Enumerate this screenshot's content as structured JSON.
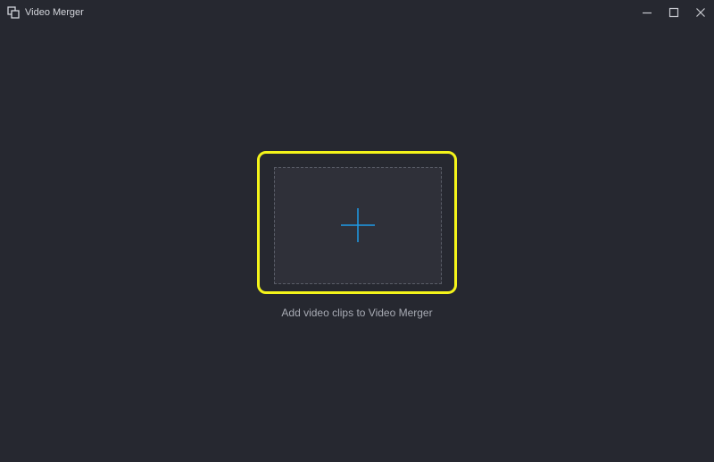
{
  "window": {
    "title": "Video Merger",
    "app_icon": "video-merger-app-icon",
    "controls": {
      "minimize_icon": "minimize-icon",
      "maximize_icon": "maximize-icon",
      "close_icon": "close-icon"
    }
  },
  "main": {
    "add_icon": "plus-icon",
    "caption": "Add video clips to Video Merger"
  },
  "colors": {
    "background": "#262830",
    "drop_zone_fill": "#2f3039",
    "drop_zone_border": "#5a5d68",
    "highlight": "#f4f41a",
    "accent": "#1e9be8",
    "text_primary": "#d4d6dc",
    "text_secondary": "#a7aab3"
  }
}
